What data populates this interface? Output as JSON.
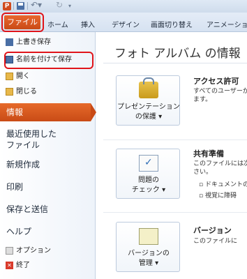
{
  "quick_access": {
    "app_icon_letter": "P"
  },
  "ribbon_tabs": {
    "file": "ファイル",
    "home": "ホーム",
    "insert": "挿入",
    "design": "デザイン",
    "transitions": "画面切り替え",
    "animations": "アニメーション"
  },
  "backstage_menu": {
    "save": "上書き保存",
    "save_as": "名前を付けて保存",
    "open": "開く",
    "close": "閉じる",
    "info": "情報",
    "recent_line1": "最近使用した",
    "recent_line2": "ファイル",
    "new": "新規作成",
    "print": "印刷",
    "save_send": "保存と送信",
    "help": "ヘルプ",
    "options": "オプション",
    "exit": "終了"
  },
  "main": {
    "title": "フォト アルバム の情報",
    "sections": [
      {
        "button_line1": "プレゼンテーション",
        "button_line2": "の保護 ▾",
        "heading": "アクセス許可",
        "text_line1": "すべてのユーザーが",
        "text_line2": "ます。"
      },
      {
        "button_line1": "問題の",
        "button_line2": "チェック ▾",
        "heading": "共有準備",
        "text_line1": "このファイルには次",
        "text_line2": "さい。",
        "bullet1": "▫ ドキュメントの",
        "bullet2": "▫ 視覚に障碍"
      },
      {
        "button_line1": "バージョンの",
        "button_line2": "管理 ▾",
        "heading": "バージョン",
        "text_line1": "このファイルに"
      }
    ]
  },
  "colors": {
    "accent": "#d04b1f",
    "highlight_box": "#e0141a"
  }
}
